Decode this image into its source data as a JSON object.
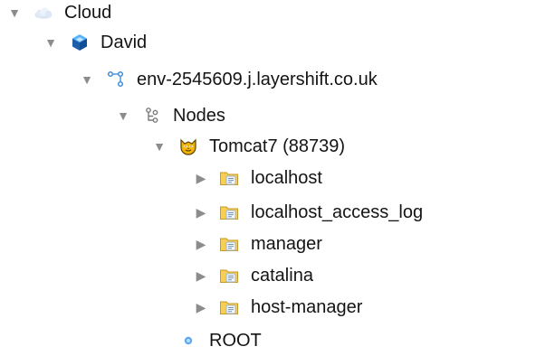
{
  "tree": {
    "nodes": [
      {
        "label": "Cloud",
        "icon": "cloud-icon",
        "expanded": true,
        "level": 0
      },
      {
        "label": "David",
        "icon": "provider-cube-icon",
        "expanded": true,
        "level": 1
      },
      {
        "label": "env-2545609.j.layershift.co.uk",
        "icon": "environment-network-icon",
        "expanded": true,
        "level": 2
      },
      {
        "label": "Nodes",
        "icon": "nodes-tree-icon",
        "expanded": true,
        "level": 3
      },
      {
        "label": "Tomcat7 (88739)",
        "icon": "tomcat-cat-icon",
        "expanded": true,
        "level": 4
      },
      {
        "label": "localhost",
        "icon": "log-folder-icon",
        "expanded": false,
        "level": 5
      },
      {
        "label": "localhost_access_log",
        "icon": "log-folder-icon",
        "expanded": false,
        "level": 5
      },
      {
        "label": "manager",
        "icon": "log-folder-icon",
        "expanded": false,
        "level": 5
      },
      {
        "label": "catalina",
        "icon": "log-folder-icon",
        "expanded": false,
        "level": 5
      },
      {
        "label": "host-manager",
        "icon": "log-folder-icon",
        "expanded": false,
        "level": 5
      },
      {
        "label": "ROOT",
        "icon": "root-dot-icon",
        "level": 4
      }
    ]
  }
}
